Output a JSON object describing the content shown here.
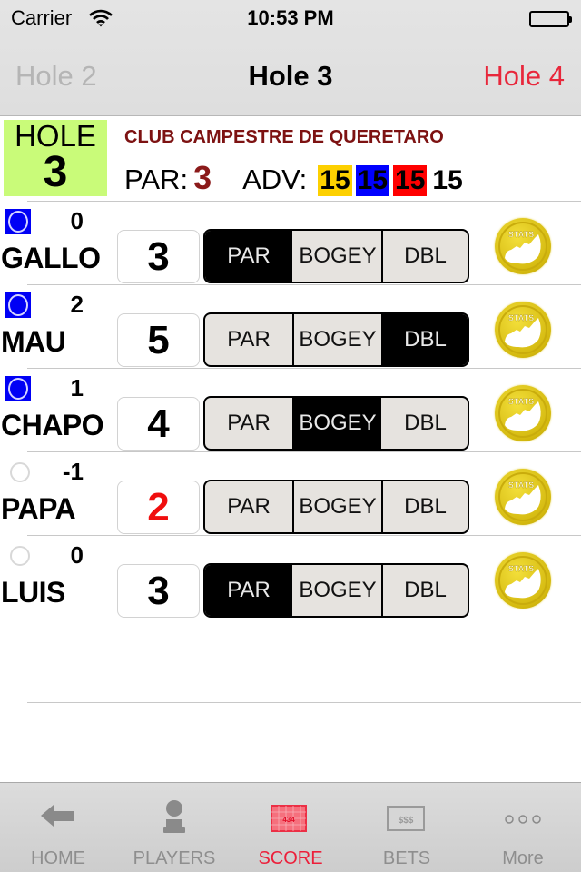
{
  "status_bar": {
    "carrier": "Carrier",
    "time": "10:53 PM"
  },
  "nav": {
    "prev": "Hole 2",
    "title": "Hole 3",
    "next": "Hole 4"
  },
  "hole": {
    "label": "HOLE",
    "number": "3",
    "club": "CLUB CAMPESTRE DE QUERETARO",
    "par_label": "PAR:",
    "par": "3",
    "adv_label": "ADV:",
    "adv": [
      {
        "value": "15",
        "color": "#fdd000"
      },
      {
        "value": "15",
        "color": "#0000ff"
      },
      {
        "value": "15",
        "color": "#ff0000"
      },
      {
        "value": "15",
        "color": ""
      }
    ]
  },
  "segment_labels": [
    "PAR",
    "BOGEY",
    "DBL"
  ],
  "players": [
    {
      "name": "GALLO",
      "total": "0",
      "selected": true,
      "score": "3",
      "under_par": false,
      "segment": "PAR"
    },
    {
      "name": "MAU",
      "total": "2",
      "selected": true,
      "score": "5",
      "under_par": false,
      "segment": "DBL"
    },
    {
      "name": "CHAPO",
      "total": "1",
      "selected": true,
      "score": "4",
      "under_par": false,
      "segment": "BOGEY"
    },
    {
      "name": "PAPA",
      "total": "-1",
      "selected": false,
      "score": "2",
      "under_par": true,
      "segment": ""
    },
    {
      "name": "LUIS",
      "total": "0",
      "selected": false,
      "score": "3",
      "under_par": false,
      "segment": "PAR"
    }
  ],
  "stats_label": "STATS",
  "tabs": [
    {
      "label": "HOME",
      "icon": "arrow-left-icon",
      "active": false
    },
    {
      "label": "PLAYERS",
      "icon": "person-icon",
      "active": false
    },
    {
      "label": "SCORE",
      "icon": "scorecard-icon",
      "active": true,
      "icon_text": "434"
    },
    {
      "label": "BETS",
      "icon": "bets-icon",
      "active": false,
      "icon_text": "$$$"
    },
    {
      "label": "More",
      "icon": "more-icon",
      "active": false
    }
  ]
}
